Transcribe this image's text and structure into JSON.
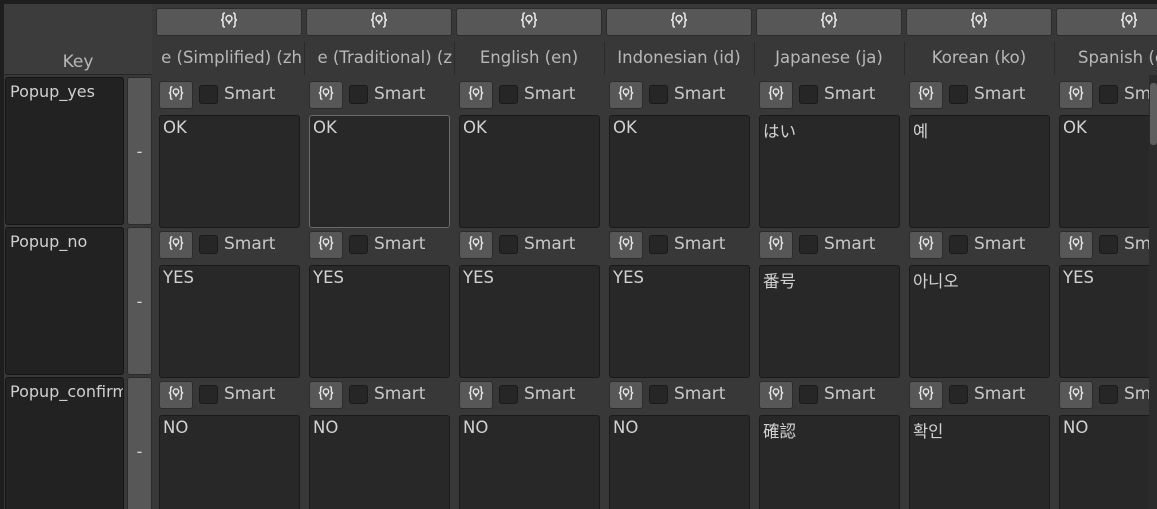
{
  "key_header": "Key",
  "remove_label": "-",
  "smart_label": "Smart",
  "icon": "code-brace-lock-icon",
  "colors": {
    "background": "#383838",
    "cell": "#282828",
    "button": "#575757",
    "text": "#d2d2d2"
  },
  "columns": [
    {
      "title": "e (Simplified) (zh"
    },
    {
      "title": "e (Traditional) (z"
    },
    {
      "title": "English (en)"
    },
    {
      "title": "Indonesian (id)"
    },
    {
      "title": "Japanese (ja)"
    },
    {
      "title": "Korean (ko)"
    },
    {
      "title": "Spanish (es)"
    }
  ],
  "rows": [
    {
      "key": "Popup_yes",
      "values": [
        "OK",
        "OK",
        "OK",
        "OK",
        "はい",
        "예",
        "OK"
      ]
    },
    {
      "key": "Popup_no",
      "values": [
        "YES",
        "YES",
        "YES",
        "YES",
        "番号",
        "아니오",
        "YES"
      ]
    },
    {
      "key": "Popup_confirm",
      "values": [
        "NO",
        "NO",
        "NO",
        "NO",
        "確認",
        "확인",
        "NO"
      ]
    }
  ]
}
